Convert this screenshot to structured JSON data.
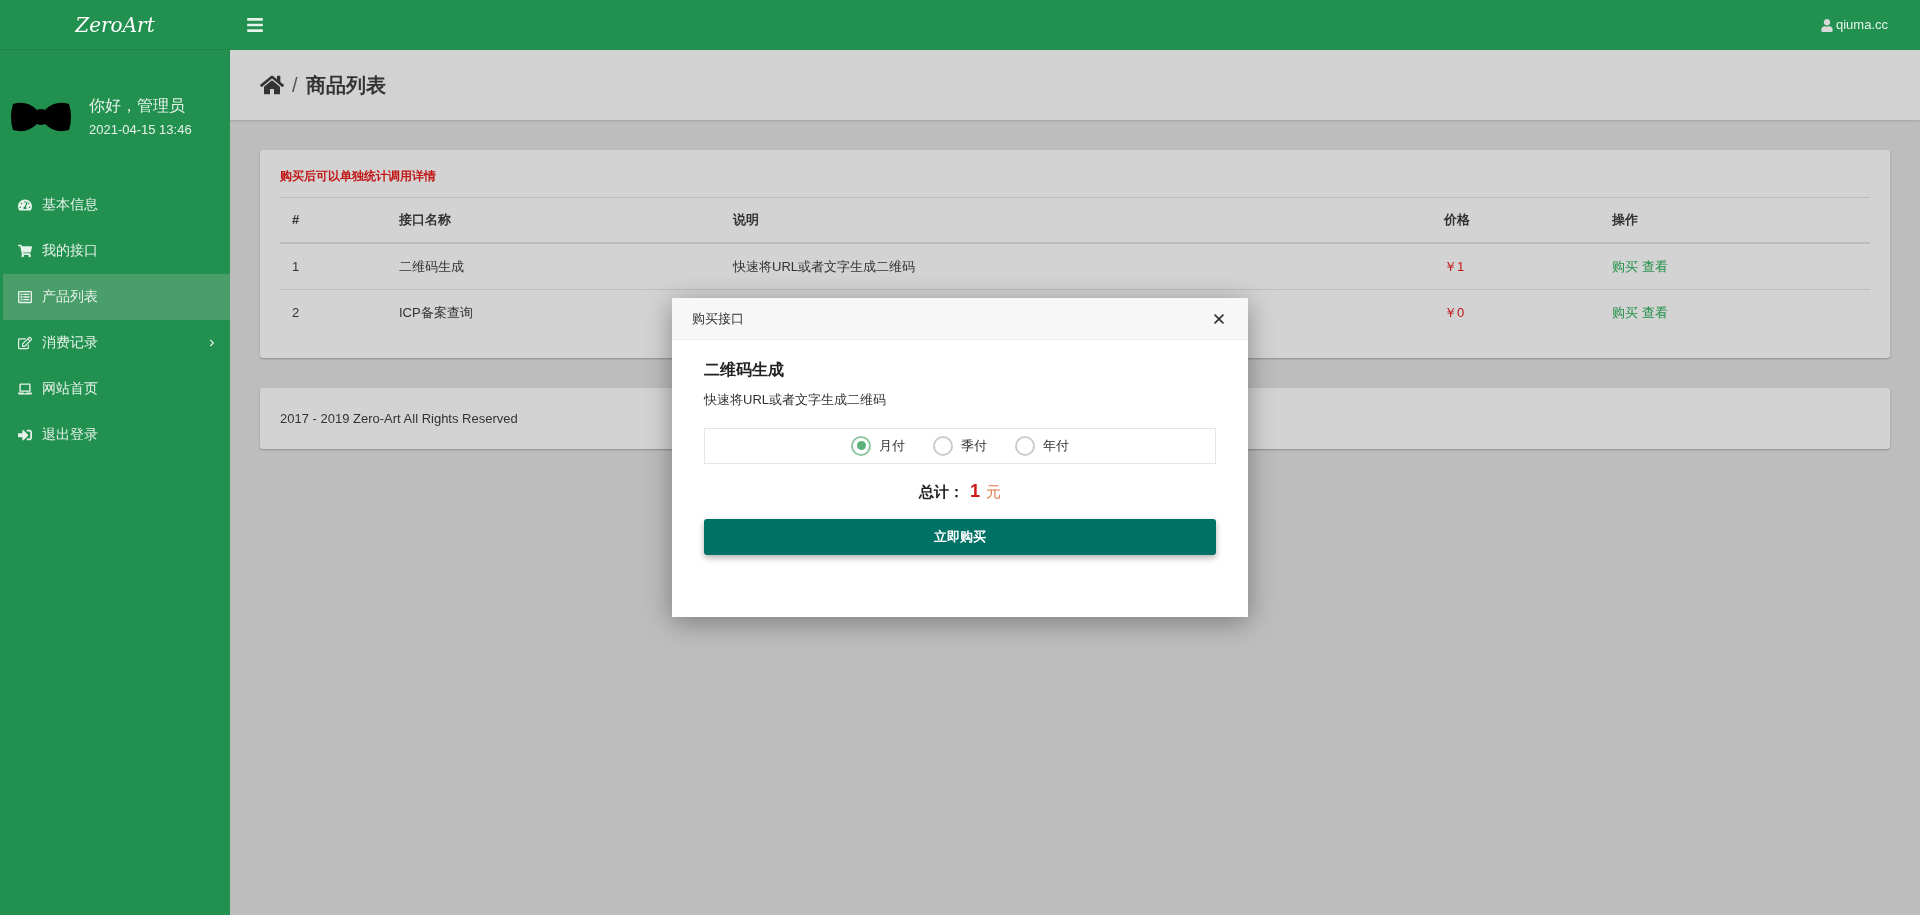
{
  "brand": "ZeroArt",
  "user": {
    "name": "qiuma.cc"
  },
  "profile": {
    "greeting": "你好，管理员",
    "datetime": "2021-04-15 13:46"
  },
  "sidebar": {
    "items": [
      {
        "label": "基本信息",
        "selected": false,
        "expandable": false
      },
      {
        "label": "我的接口",
        "selected": false,
        "expandable": false
      },
      {
        "label": "产品列表",
        "selected": true,
        "expandable": false
      },
      {
        "label": "消费记录",
        "selected": false,
        "expandable": true
      },
      {
        "label": "网站首页",
        "selected": false,
        "expandable": false
      },
      {
        "label": "退出登录",
        "selected": false,
        "expandable": false
      }
    ]
  },
  "breadcrumb": {
    "separator": "/",
    "title": "商品列表"
  },
  "notice": "购买后可以单独统计调用详情",
  "table": {
    "columns": [
      "#",
      "接口名称",
      "说明",
      "价格",
      "操作"
    ],
    "rows": [
      {
        "index": "1",
        "name": "二维码生成",
        "description": "快速将URL或者文字生成二维码",
        "price": "￥1",
        "actions": [
          "购买",
          "查看"
        ]
      },
      {
        "index": "2",
        "name": "ICP备案查询",
        "price": "￥0",
        "actions": [
          "购买",
          "查看"
        ]
      }
    ]
  },
  "footer": "2017 - 2019 Zero-Art All Rights Reserved",
  "modal": {
    "title": "购买接口",
    "product": "二维码生成",
    "description": "快速将URL或者文字生成二维码",
    "plans": [
      {
        "label": "月付",
        "selected": true
      },
      {
        "label": "季付",
        "selected": false
      },
      {
        "label": "年付",
        "selected": false
      }
    ],
    "total_label": "总计：",
    "total_value": "1",
    "total_unit": "元",
    "button": "立即购买"
  }
}
